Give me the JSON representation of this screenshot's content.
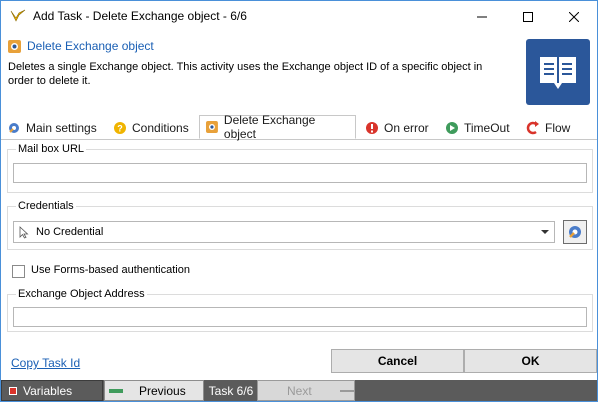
{
  "window": {
    "title": "Add Task - Delete Exchange object - 6/6"
  },
  "header": {
    "title": "Delete Exchange object",
    "description": "Deletes a single Exchange object. This activity uses the Exchange object ID of a specific object in order to delete it.",
    "icon": "exchange-document-icon",
    "accent_color": "#2b579a"
  },
  "tabs": [
    {
      "label": "Main settings",
      "icon": "gear-icon"
    },
    {
      "label": "Conditions",
      "icon": "conditions-icon"
    },
    {
      "label": "Delete Exchange object",
      "icon": "exchange-icon",
      "active": true
    },
    {
      "label": "On error",
      "icon": "error-icon"
    },
    {
      "label": "TimeOut",
      "icon": "timeout-icon"
    },
    {
      "label": "Flow",
      "icon": "flow-icon"
    }
  ],
  "form": {
    "mailbox_url": {
      "label": "Mail box URL",
      "value": ""
    },
    "credentials": {
      "label": "Credentials",
      "selected": "No Credential"
    },
    "forms_auth": {
      "label": "Use Forms-based authentication",
      "checked": false
    },
    "exchange_address": {
      "label": "Exchange Object Address",
      "value": ""
    }
  },
  "footer": {
    "copy_link": "Copy Task Id",
    "cancel_label": "Cancel",
    "ok_label": "OK"
  },
  "statusbar": {
    "variables_label": "Variables",
    "previous_label": "Previous",
    "task_label": "Task 6/6",
    "next_label": "Next"
  }
}
